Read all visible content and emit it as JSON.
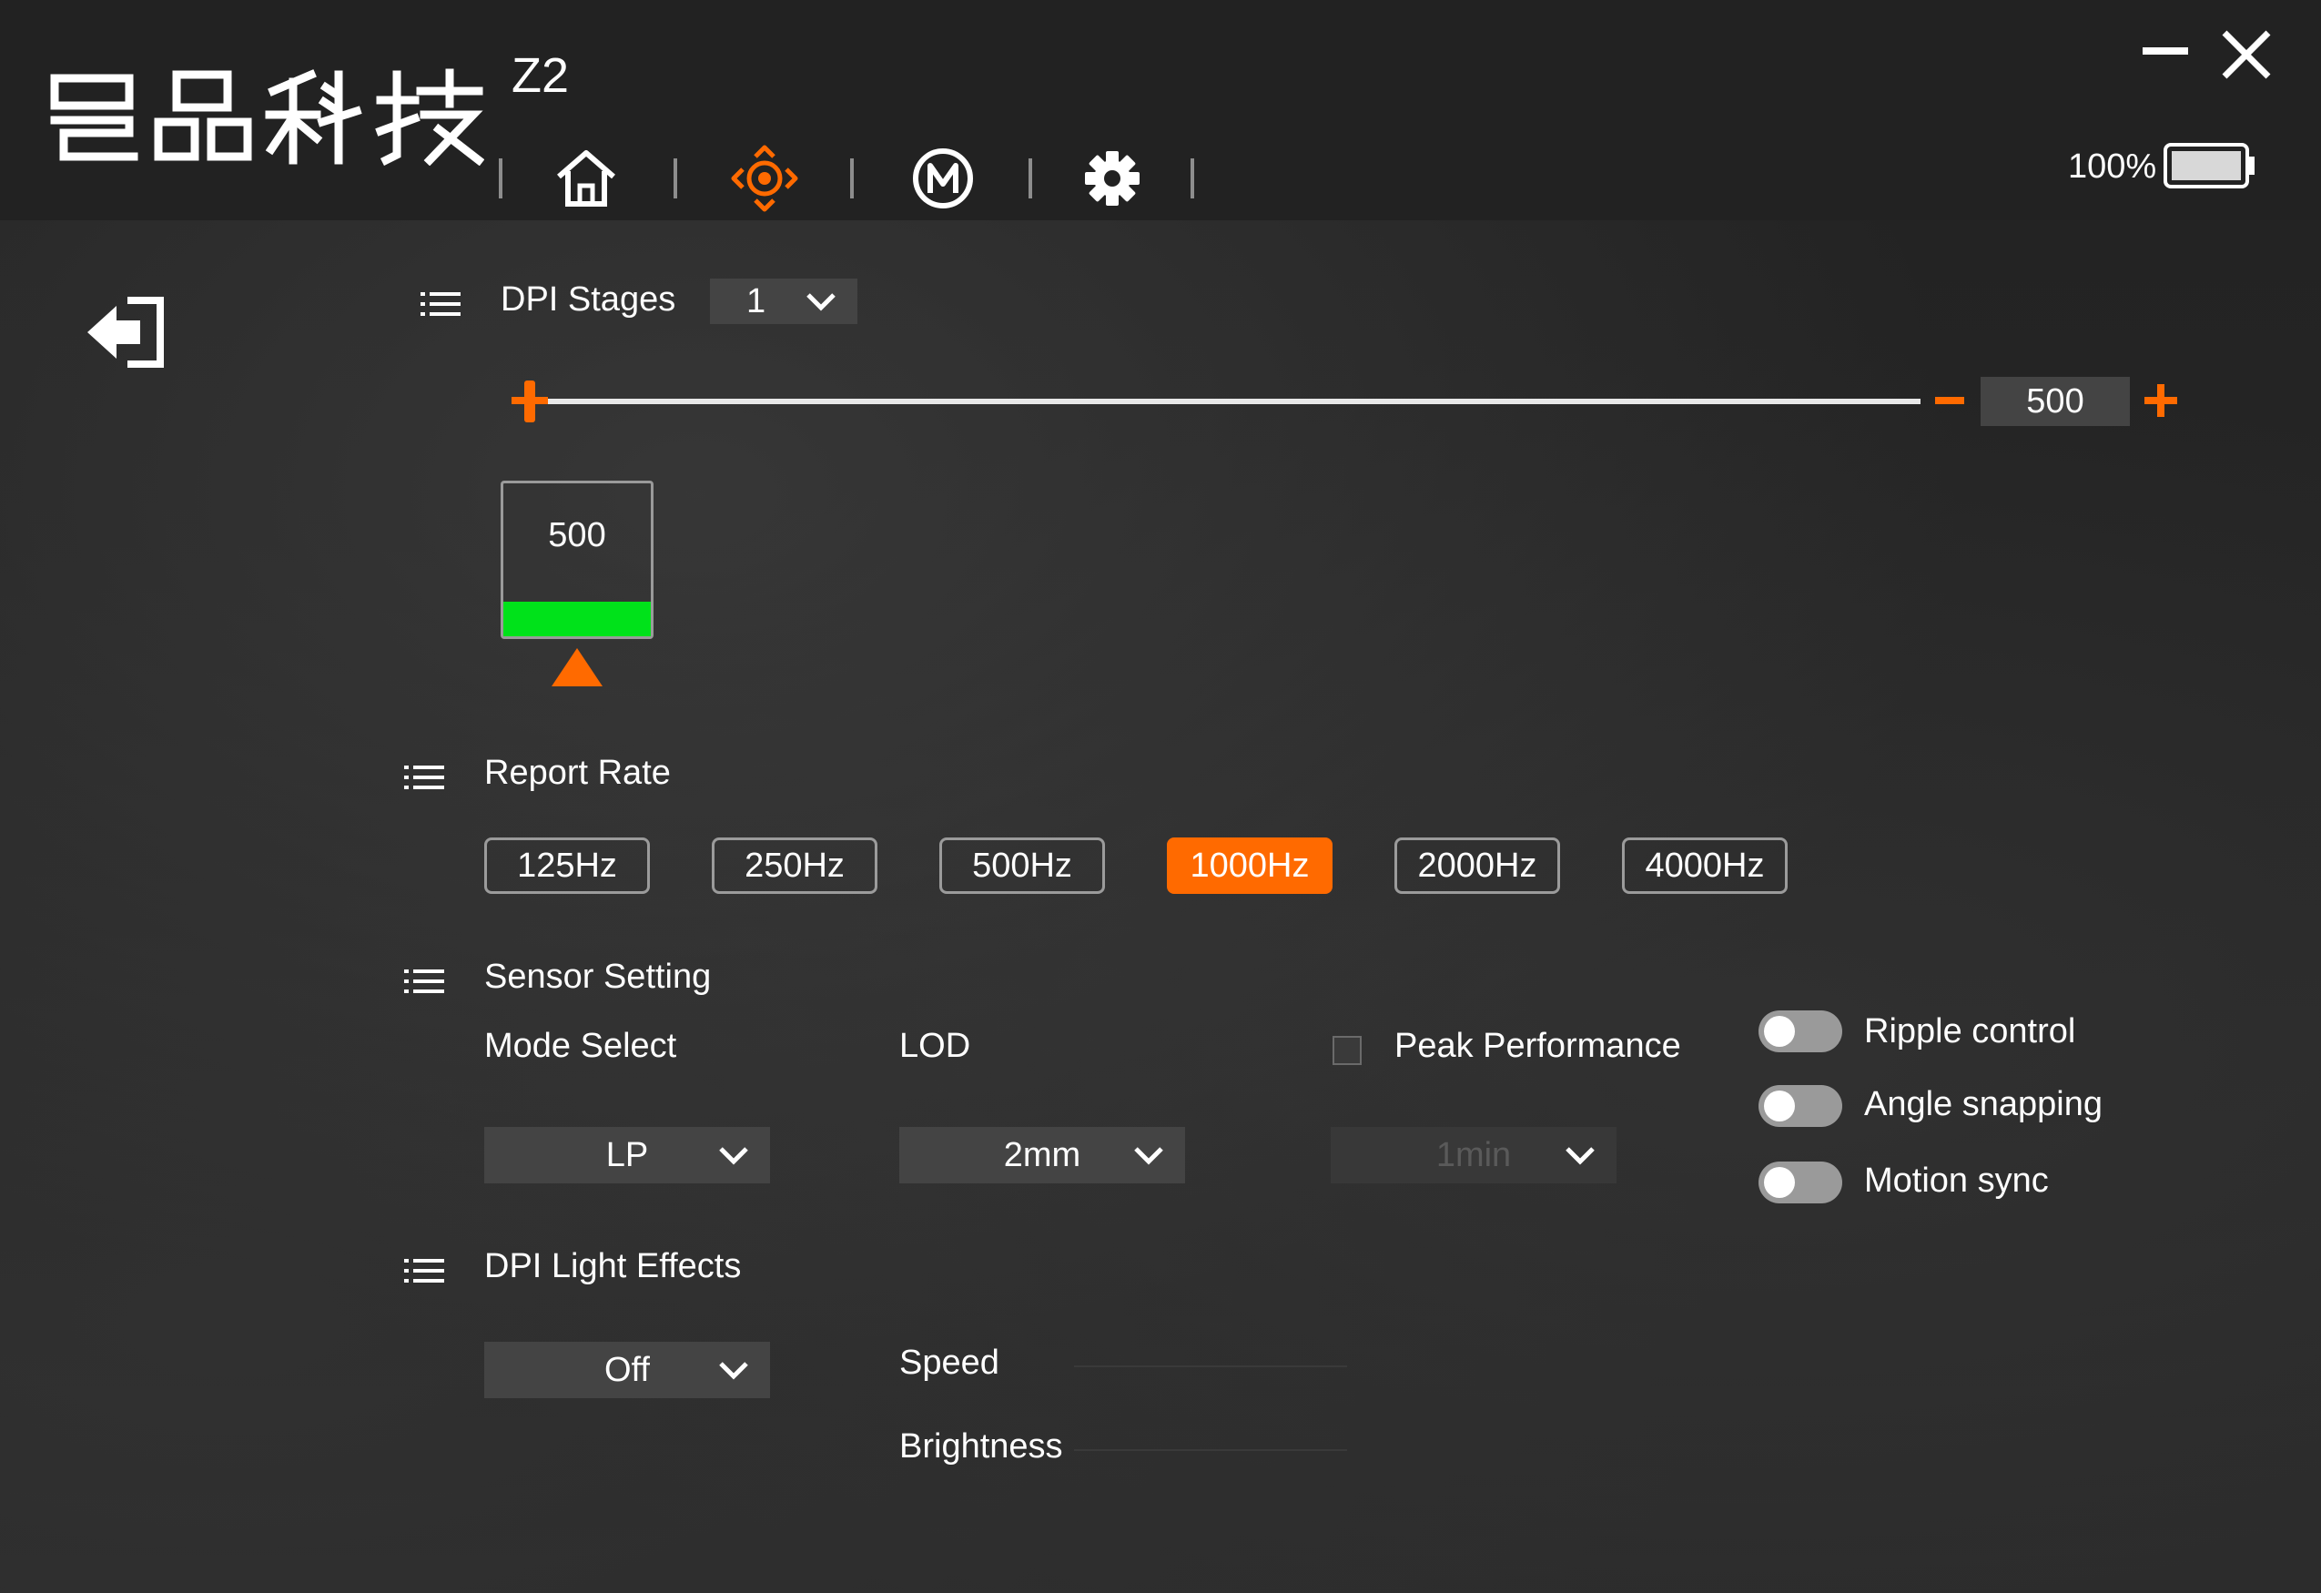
{
  "app": {
    "brand": "昌品科技",
    "model": "Z2",
    "battery_percent": "100%",
    "battery_level": 1.0,
    "accent_color": "#ff6a00"
  },
  "nav": [
    {
      "icon": "home-icon"
    },
    {
      "icon": "move-arrows-icon",
      "active": true
    },
    {
      "icon": "macro-m-icon"
    },
    {
      "icon": "gear-icon"
    }
  ],
  "window_controls": {
    "minimize": "minimize-icon",
    "close": "close-icon"
  },
  "dpi": {
    "section_title": "DPI Stages",
    "stages_value": "1",
    "slider_value": "500",
    "slider_level": 0.0,
    "stages": [
      {
        "value": "500",
        "color": "#00e21a",
        "selected": true
      }
    ]
  },
  "report_rate": {
    "section_title": "Report Rate",
    "options": [
      "125Hz",
      "250Hz",
      "500Hz",
      "1000Hz",
      "2000Hz",
      "4000Hz"
    ],
    "selected": "1000Hz"
  },
  "sensor": {
    "section_title": "Sensor Setting",
    "mode_label": "Mode Select",
    "mode_value": "LP",
    "lod_label": "LOD",
    "lod_value": "2mm",
    "peak_label": "Peak Performance",
    "peak_checked": false,
    "peak_value": "1min",
    "toggles": [
      {
        "label": "Ripple control",
        "on": false
      },
      {
        "label": "Angle snapping",
        "on": false
      },
      {
        "label": "Motion sync",
        "on": false
      }
    ]
  },
  "light": {
    "section_title": "DPI Light Effects",
    "effect_value": "Off",
    "speed_label": "Speed",
    "brightness_label": "Brightness"
  }
}
